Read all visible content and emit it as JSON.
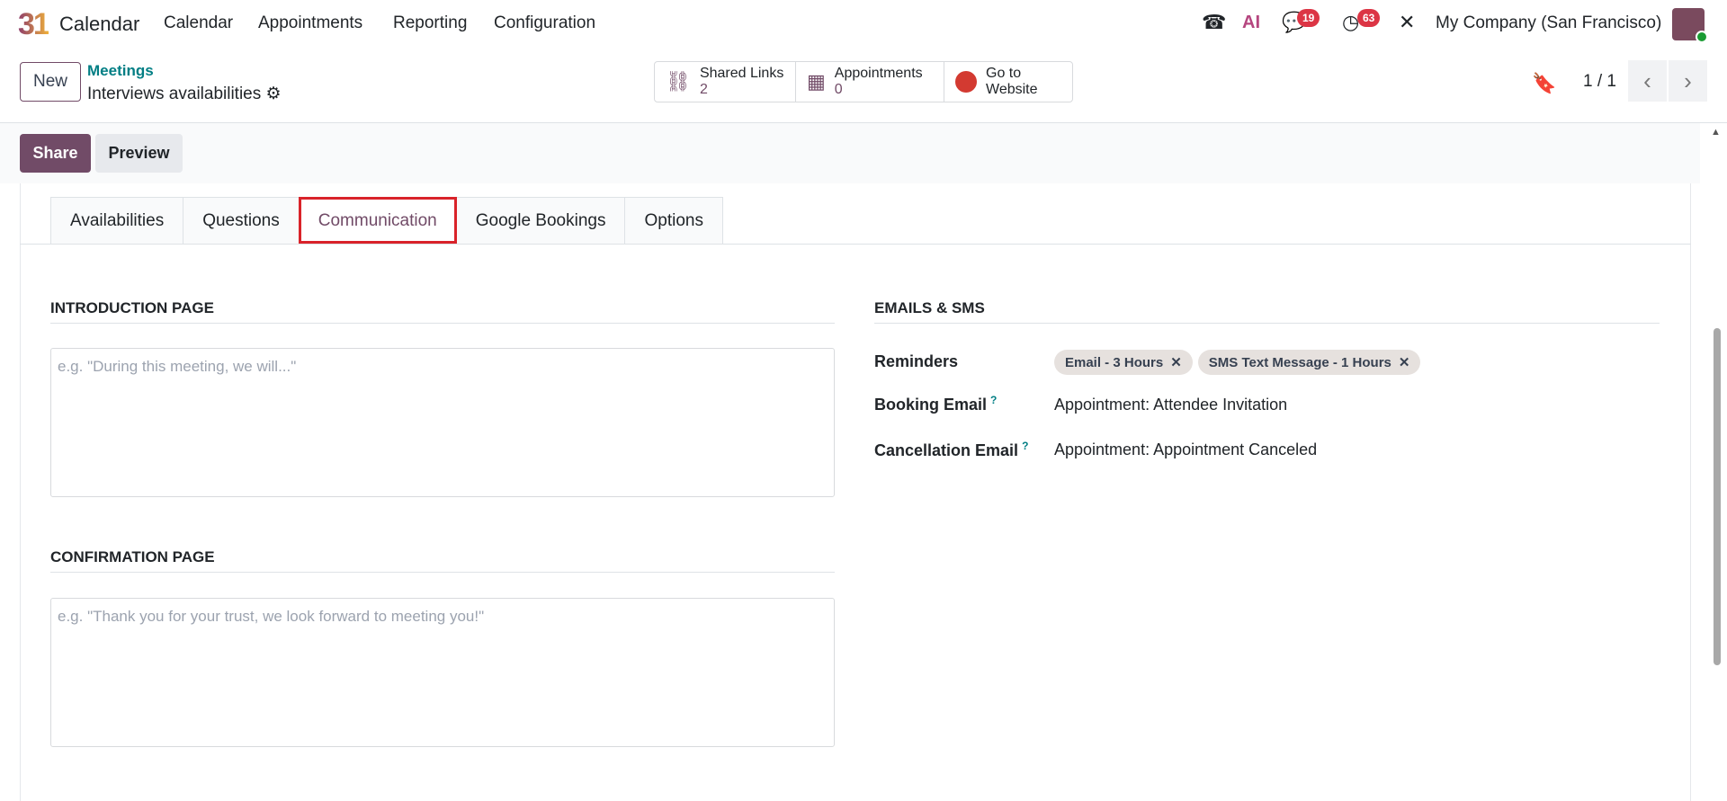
{
  "nav": {
    "logo": "31",
    "app": "Calendar",
    "menu": [
      "Calendar",
      "Appointments",
      "Reporting",
      "Configuration"
    ],
    "chat_badge": "19",
    "activity_badge": "63",
    "company": "My Company (San Francisco)",
    "ai": "AI"
  },
  "control": {
    "new": "New",
    "breadcrumb": "Meetings",
    "record": "Interviews availabilities",
    "pager": "1 / 1"
  },
  "stats": [
    {
      "label": "Shared Links",
      "value": "2"
    },
    {
      "label": "Appointments",
      "value": "0"
    },
    {
      "label": "Go to",
      "value": "Website"
    }
  ],
  "actions": {
    "share": "Share",
    "preview": "Preview"
  },
  "tabs": [
    "Availabilities",
    "Questions",
    "Communication",
    "Google Bookings",
    "Options"
  ],
  "intro": {
    "title": "INTRODUCTION PAGE",
    "placeholder": "e.g. \"During this meeting, we will...\""
  },
  "confirm": {
    "title": "CONFIRMATION PAGE",
    "placeholder": "e.g. \"Thank you for your trust, we look forward to meeting you!\""
  },
  "emails": {
    "title": "EMAILS & SMS",
    "reminders_label": "Reminders",
    "reminders": [
      "Email - 3 Hours",
      "SMS Text Message - 1 Hours"
    ],
    "booking_label": "Booking Email",
    "booking_value": "Appointment: Attendee Invitation",
    "cancel_label": "Cancellation Email",
    "cancel_value": "Appointment: Appointment Canceled",
    "help": "?"
  },
  "colors": {
    "brand": "#714b67",
    "link": "#017e84",
    "highlight": "#d9232a"
  }
}
